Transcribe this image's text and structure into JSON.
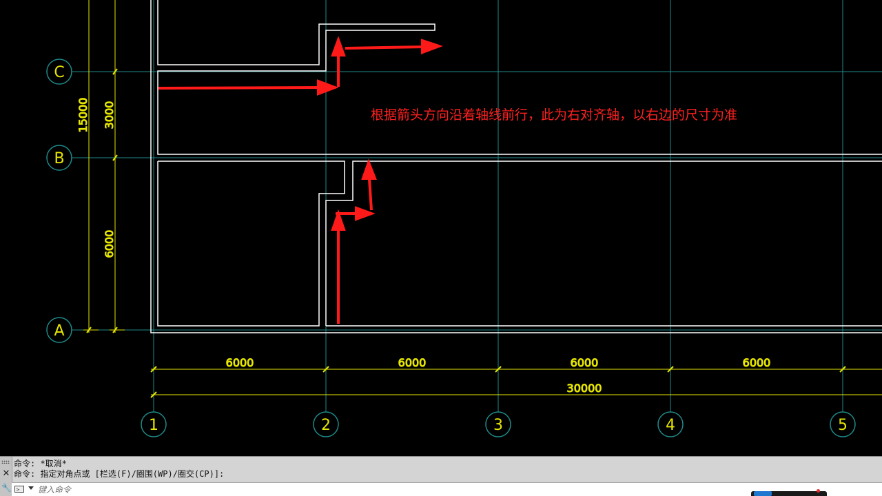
{
  "drawing": {
    "row_axes": [
      "C",
      "B",
      "A"
    ],
    "column_axes": [
      "1",
      "2",
      "3",
      "4",
      "5"
    ],
    "vertical_dims": {
      "total": "15000",
      "segments": [
        "3000",
        "6000"
      ]
    },
    "horizontal_dims": {
      "segments": [
        "6000",
        "6000",
        "6000",
        "6000"
      ],
      "total": "30000"
    },
    "annotation": "根据箭头方向沿着轴线前行，此为右对齐轴，以右边的尺寸为准",
    "colors": {
      "background": "#000000",
      "axis_line": "#1f8a8a",
      "dimension": "#e6e600",
      "wall": "#ffffff",
      "arrow": "#ff1a1a",
      "bubble": "#1f8a8a"
    }
  },
  "command_line": {
    "history": [
      "命令: *取消*",
      "命令: 指定对角点或 [栏选(F)/圈围(WP)/圈交(CP)]:"
    ],
    "placeholder": "键入命令"
  }
}
